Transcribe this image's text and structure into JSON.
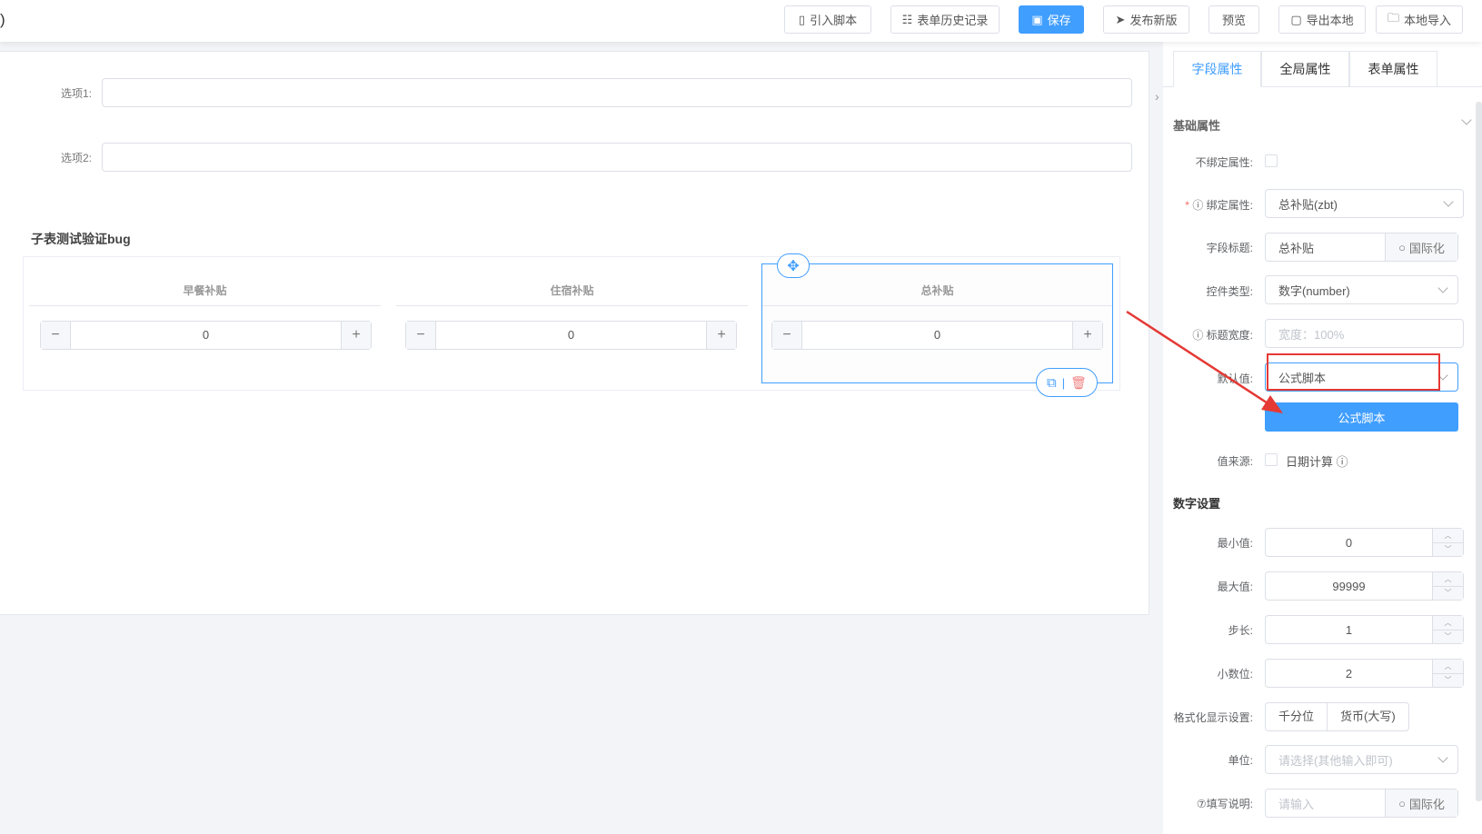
{
  "header": {
    "title_fragment": ")",
    "buttons": [
      {
        "label": "引入脚本",
        "icon": "script-icon"
      },
      {
        "label": "表单历史记录",
        "icon": "list-icon"
      },
      {
        "label": "保存",
        "icon": "save-icon"
      },
      {
        "label": "发布新版",
        "icon": "send-icon"
      },
      {
        "label": "预览"
      },
      {
        "label": "导出本地",
        "icon": "file-icon"
      },
      {
        "label": "本地导入",
        "icon": "folder-icon"
      }
    ]
  },
  "form": {
    "option1_label": "选项1:",
    "option2_label": "选项2:",
    "option1_value": "",
    "option2_value": "",
    "subtable": {
      "title": "子表测试验证bug",
      "columns": [
        {
          "header": "早餐补贴",
          "value": "0"
        },
        {
          "header": "住宿补贴",
          "value": "0"
        },
        {
          "header": "总补贴",
          "value": "0"
        }
      ]
    }
  },
  "panel": {
    "tabs": [
      "字段属性",
      "全局属性",
      "表单属性"
    ],
    "basic_section": "基础属性",
    "unbind_label": "不绑定属性:",
    "bind_label": "绑定属性:",
    "bind_value": "总补贴(zbt)",
    "field_title_label": "字段标题:",
    "field_title_value": "总补贴",
    "i18n": "国际化",
    "control_type_label": "控件类型:",
    "control_type_value": "数字(number)",
    "title_width_label": "标题宽度:",
    "title_width_placeholder": "宽度：100%",
    "default_label": "默认值:",
    "default_value": "公式脚本",
    "formula_button": "公式脚本",
    "source_label": "值来源:",
    "date_calc": "日期计算",
    "number_section": "数字设置",
    "min_label": "最小值:",
    "min_value": "0",
    "max_label": "最大值:",
    "max_value": "99999",
    "step_label": "步长:",
    "step_value": "1",
    "decimal_label": "小数位:",
    "decimal_value": "2",
    "format_label": "格式化显示设置:",
    "format_options": [
      "千分位",
      "货币(大写)"
    ],
    "unit_label": "单位:",
    "unit_placeholder": "请选择(其他输入即可)",
    "help_label": "⑦填写说明:",
    "help_placeholder": "请输入"
  },
  "colors": {
    "primary": "#409eff",
    "annotation": "#e53935"
  }
}
